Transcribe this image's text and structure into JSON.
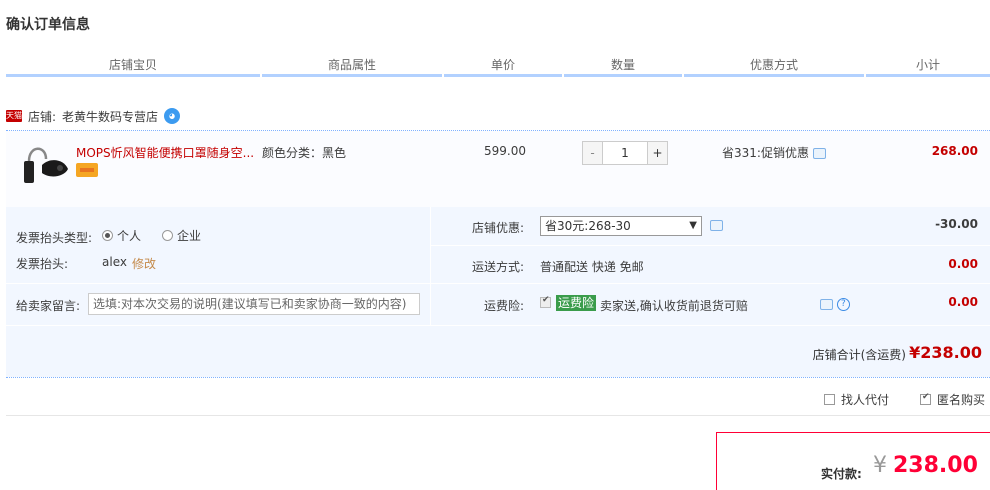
{
  "page_title": "确认订单信息",
  "columns": [
    "店铺宝贝",
    "商品属性",
    "单价",
    "数量",
    "优惠方式",
    "小计"
  ],
  "shop": {
    "badge": "天猫",
    "label": "店铺:",
    "name": "老黄牛数码专营店"
  },
  "item": {
    "title": "MOPS忻风智能便携口罩随身空...",
    "attr": "颜色分类：黑色",
    "unit_price": "599.00",
    "quantity": "1",
    "minus": "-",
    "plus": "+",
    "discount": "省331:促销优惠",
    "subtotal": "268.00"
  },
  "invoice": {
    "type_label": "发票抬头类型:",
    "options": [
      "个人",
      "企业"
    ],
    "selected": "个人",
    "head_label": "发票抬头:",
    "head_value": "alex",
    "edit": "修改"
  },
  "message": {
    "label": "给卖家留言:",
    "placeholder": "选填:对本次交易的说明(建议填写已和卖家协商一致的内容)"
  },
  "store_discount": {
    "label": "店铺优惠:",
    "selected": "省30元:268-30",
    "value": "-30.00"
  },
  "shipping": {
    "label": "运送方式:",
    "value": "普通配送 快递 免邮",
    "price": "0.00"
  },
  "insurance": {
    "label": "运费险:",
    "tag": "运费险",
    "desc": "卖家送,确认收货前退货可赔",
    "price": "0.00"
  },
  "store_total": {
    "label": "店铺合计(含运费)",
    "value": "¥238.00"
  },
  "options": {
    "proxy_pay": "找人代付",
    "anonymous": "匿名购买"
  },
  "payment": {
    "label": "实付款:",
    "currency": "¥",
    "value": "238.00"
  }
}
